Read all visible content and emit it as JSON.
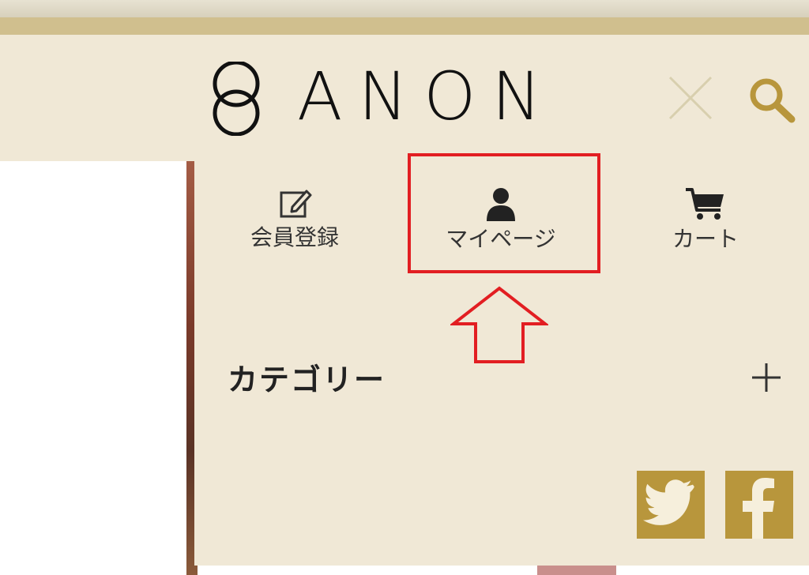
{
  "brand": {
    "name": "ANON"
  },
  "header_icons": {
    "close": "close-icon",
    "search": "search-icon"
  },
  "menu": {
    "items": [
      {
        "label": "会員登録",
        "icon": "edit-icon"
      },
      {
        "label": "マイページ",
        "icon": "user-icon"
      },
      {
        "label": "カート",
        "icon": "cart-icon"
      }
    ]
  },
  "category": {
    "title": "カテゴリー",
    "toggle_icon": "plus-icon"
  },
  "social": {
    "twitter": "twitter-icon",
    "facebook": "facebook-icon"
  },
  "colors": {
    "panel_bg": "#f0e8d6",
    "gold": "#b8963c",
    "gold_bar": "#d0bf8e",
    "highlight": "#e21e22",
    "text": "#333333"
  }
}
